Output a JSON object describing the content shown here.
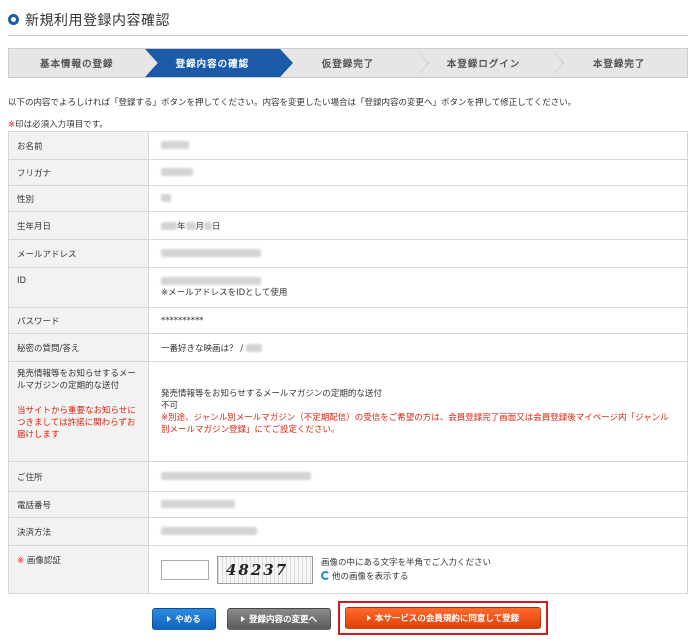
{
  "page": {
    "title": "新規利用登録内容確認"
  },
  "steps": [
    {
      "label": "基本情報の登録",
      "active": false
    },
    {
      "label": "登録内容の確認",
      "active": true
    },
    {
      "label": "仮登録完了",
      "active": false
    },
    {
      "label": "本登録ログイン",
      "active": false
    },
    {
      "label": "本登録完了",
      "active": false
    }
  ],
  "intro": "以下の内容でよろしければ「登録する」ボタンを押してください。内容を変更したい場合は「登録内容の変更へ」ボタンを押して修正してください。",
  "required_note": {
    "mark": "※",
    "text": "印は必須入力項目です。"
  },
  "fields": {
    "name": {
      "label": "お名前"
    },
    "furigana": {
      "label": "フリガナ"
    },
    "gender": {
      "label": "性別"
    },
    "birthday": {
      "label": "生年月日",
      "year": "年",
      "month": "月",
      "day": "日"
    },
    "email": {
      "label": "メールアドレス"
    },
    "id": {
      "label": "ID",
      "note": "※メールアドレスをIDとして使用"
    },
    "password": {
      "label": "パスワード",
      "value": "**********"
    },
    "secret": {
      "label": "秘密の質問/答え",
      "value": "一番好きな映画は？ / "
    },
    "newsletter": {
      "label": "発売情報等をお知らせするメールマガジンの定期的な送付",
      "label_note": "当サイトから重要なお知らせにつきましては許諾に関わらずお届けします",
      "value_title": "発売情報等をお知らせするメールマガジンの定期的な送付",
      "value": "不可",
      "value_note": "※別途、ジャンル別メールマガジン（不定期配信）の受信をご希望の方は、会員登録完了画面又は会員登録後マイページ内「ジャンル別メールマガジン登録」にてご設定ください。"
    },
    "address": {
      "label": "ご住所"
    },
    "phone": {
      "label": "電話番号"
    },
    "payment": {
      "label": "決済方法"
    },
    "captcha": {
      "mark": "※",
      "label": "画像認証",
      "image_text": "48237",
      "help": "画像の中にある文字を半角でご入力ください",
      "refresh": "他の画像を表示する",
      "input_value": ""
    }
  },
  "buttons": {
    "cancel": "やめる",
    "edit": "登録内容の変更へ",
    "submit": "本サービスの会員規約に同意して登録"
  },
  "colors": {
    "accent": "#1b5aa8",
    "required": "#d9230f",
    "submit": "#f05a1a",
    "highlight": "#d11b22"
  }
}
